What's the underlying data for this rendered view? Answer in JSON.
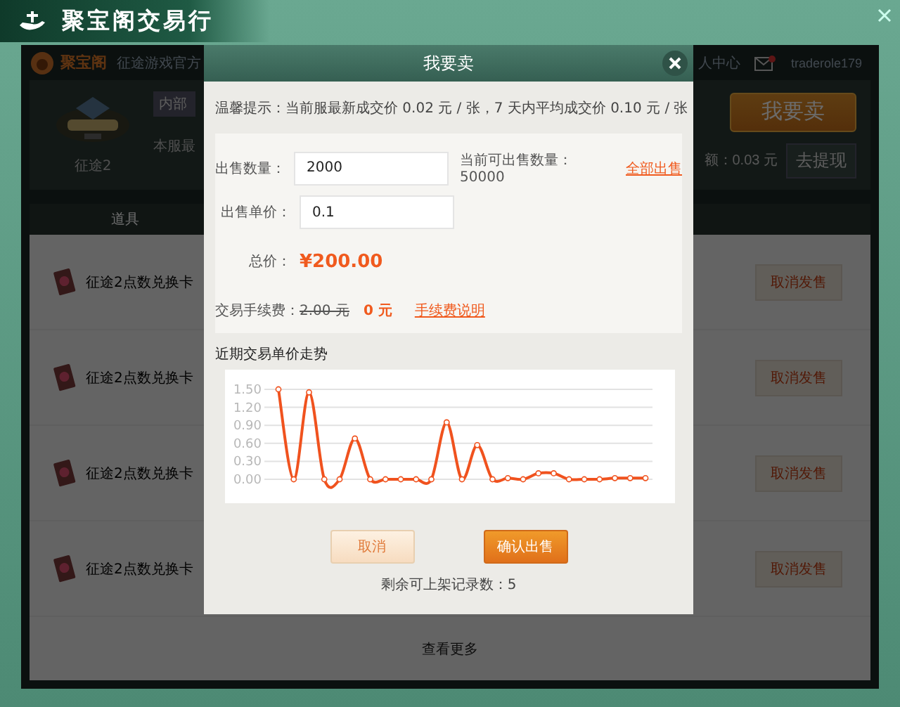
{
  "window": {
    "title": "聚宝阁交易行"
  },
  "header": {
    "brand": "聚宝阁",
    "tagline": "征途游戏官方",
    "user_center": "人中心",
    "username": "traderole179"
  },
  "game": {
    "name": "征途2",
    "tag": "内部",
    "notice": "本服最",
    "sell_button": "我要卖",
    "balance": "额：0.03 元",
    "withdraw_button": "去提现"
  },
  "table": {
    "columns": [
      "道具"
    ],
    "rows": [
      {
        "item": "征途2点数兑换卡",
        "action": "取消发售"
      },
      {
        "item": "征途2点数兑换卡",
        "action": "取消发售"
      },
      {
        "item": "征途2点数兑换卡",
        "action": "取消发售"
      },
      {
        "item": "征途2点数兑换卡",
        "action": "取消发售"
      }
    ],
    "more": "查看更多"
  },
  "dialog": {
    "title": "我要卖",
    "tip": "温馨提示：当前服最新成交价 0.02 元 / 张，7 天内平均成交价 0.10 元 / 张",
    "quantity": {
      "label": "出售数量：",
      "value": "2000",
      "available": "当前可出售数量：50000",
      "link": "全部出售"
    },
    "price": {
      "label": "出售单价：",
      "value": "0.1"
    },
    "total": {
      "label": "总价：",
      "value": "¥200.00"
    },
    "fee": {
      "label": "交易手续费：",
      "original": "2.00 元",
      "current": "0 元",
      "link": "手续费说明"
    },
    "chart_data": {
      "type": "line",
      "title": "近期交易单价走势",
      "grid": true,
      "ylim": [
        0,
        1.5
      ],
      "yticks": [
        {
          "value": 0,
          "label": "0.00"
        },
        {
          "value": 0.3,
          "label": "0.30"
        },
        {
          "value": 0.6,
          "label": "0.60"
        },
        {
          "value": 0.9,
          "label": "0.90"
        },
        {
          "value": 1.2,
          "label": "1.20"
        },
        {
          "value": 1.5,
          "label": "1.50"
        }
      ],
      "series": [
        {
          "color": "#f0521e",
          "marker": true,
          "values": [
            1.5,
            0,
            1.45,
            0,
            0,
            0.68,
            0,
            0,
            0,
            0,
            0,
            0.95,
            0,
            0.57,
            0,
            0.02,
            0,
            0.1,
            0.1,
            0,
            0,
            0,
            0.02,
            0.02,
            0.02
          ]
        }
      ]
    },
    "buttons": [
      {
        "kind": "secondary",
        "label": "取消"
      },
      {
        "kind": "primary",
        "label": "确认出售"
      }
    ],
    "remaining": "剩余可上架记录数：5"
  }
}
